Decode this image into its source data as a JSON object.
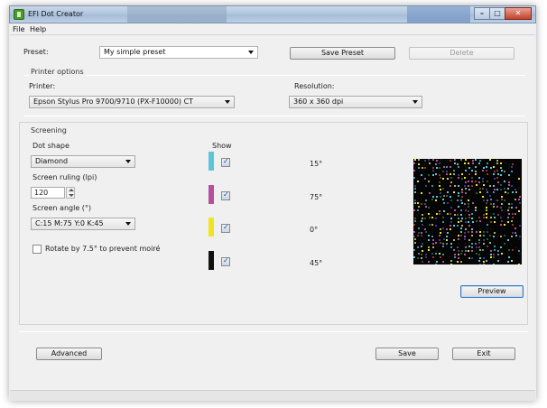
{
  "window": {
    "title": "EFI Dot Creator"
  },
  "menu": {
    "items": [
      "File",
      "Help"
    ]
  },
  "preset": {
    "label": "Preset:",
    "value": "My simple preset",
    "save_label": "Save Preset",
    "delete_label": "Delete"
  },
  "printer_options": {
    "title": "Printer options",
    "printer_label": "Printer:",
    "printer_value": "Epson Stylus Pro 9700/9710 (PX-F10000) CT",
    "resolution_label": "Resolution:",
    "resolution_value": "360 x 360 dpi"
  },
  "screening": {
    "title": "Screening",
    "dot_shape_label": "Dot shape",
    "dot_shape_value": "Diamond",
    "ruling_label": "Screen ruling (lpi)",
    "ruling_value": "120",
    "angle_label": "Screen angle (°)",
    "angle_value": "C:15 M:75 Y:0 K:45",
    "rotate_label": "Rotate by 7.5° to prevent moiré",
    "rotate_checked": false,
    "show_label": "Show",
    "channels": [
      {
        "color": "#5cc5d8",
        "checked": true,
        "angle": "15°"
      },
      {
        "color": "#b4509e",
        "checked": true,
        "angle": "75°"
      },
      {
        "color": "#f2e41c",
        "checked": true,
        "angle": "0°"
      },
      {
        "color": "#111111",
        "checked": true,
        "angle": "45°"
      }
    ],
    "preview_label": "Preview"
  },
  "footer": {
    "advanced_label": "Advanced",
    "save_label": "Save",
    "exit_label": "Exit"
  }
}
